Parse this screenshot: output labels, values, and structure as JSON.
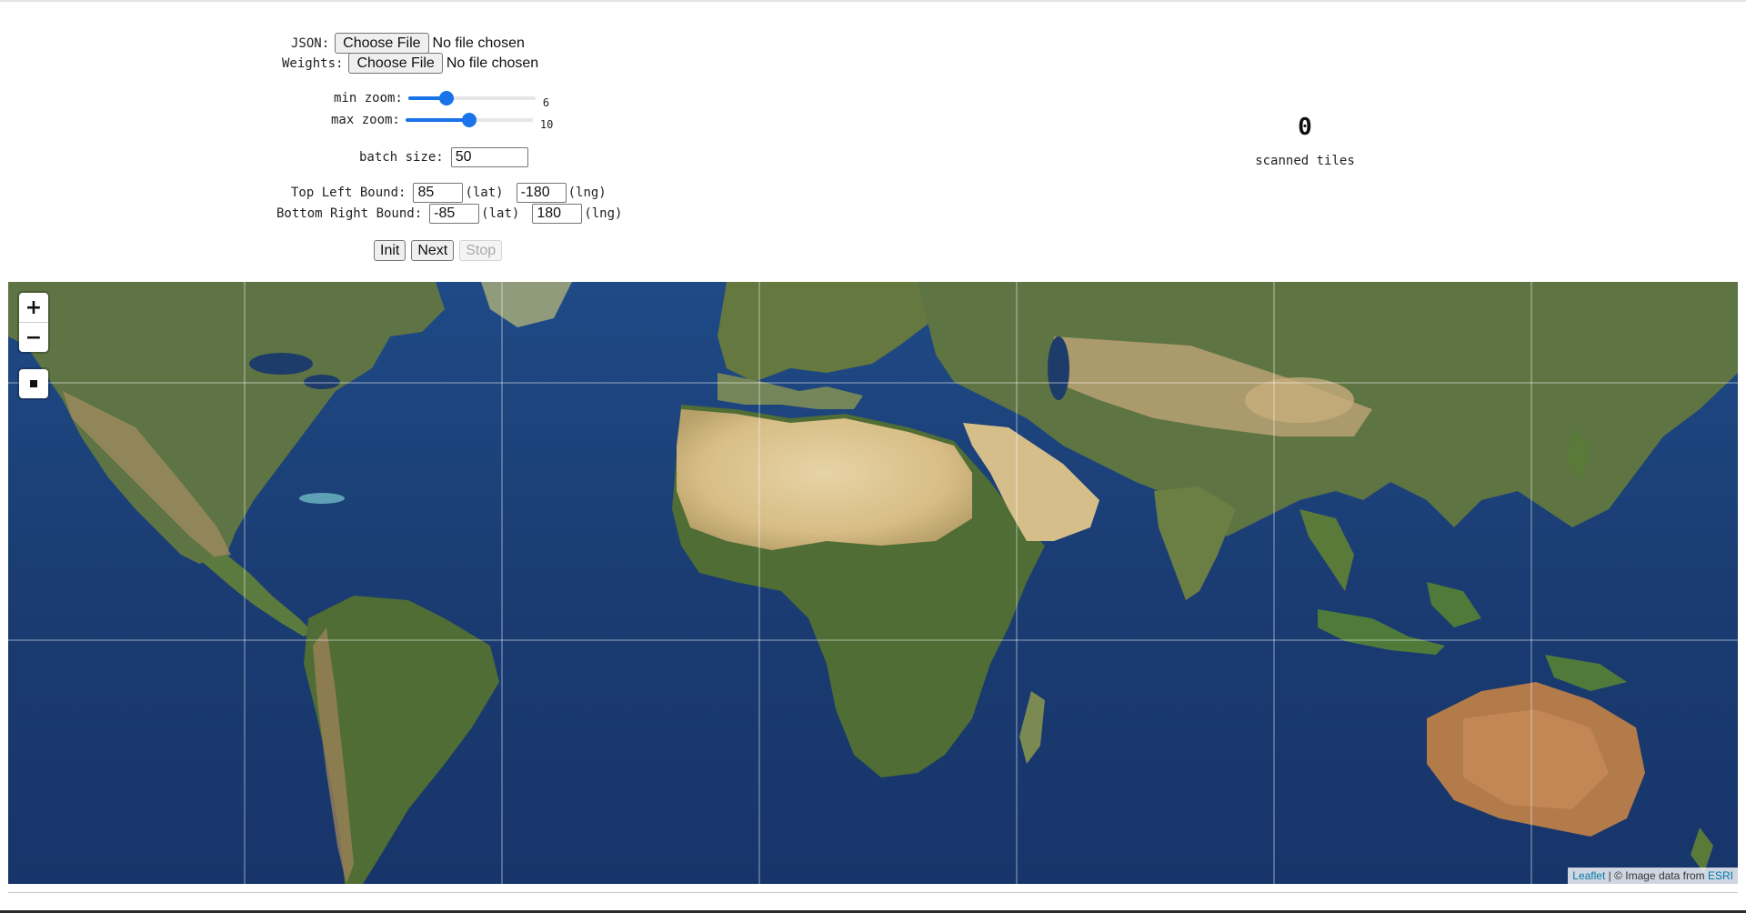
{
  "form": {
    "json_label": "JSON:",
    "weights_label": "Weights:",
    "choose_file_label": "Choose File",
    "no_file_text": "No file chosen",
    "min_zoom_label": "min zoom:",
    "min_zoom_value": "6",
    "min_zoom_fraction": 0.3,
    "max_zoom_label": "max zoom:",
    "max_zoom_value": "10",
    "max_zoom_fraction": 0.5,
    "batch_size_label": "batch size:",
    "batch_size_value": "50",
    "top_left_label": "Top Left Bound:",
    "top_left_lat": "85",
    "top_left_lng": "-180",
    "bottom_right_label": "Bottom Right Bound:",
    "bottom_right_lat": "-85",
    "bottom_right_lng": "180",
    "lat_suffix": "(lat)",
    "lng_suffix": "(lng)",
    "init_label": "Init",
    "next_label": "Next",
    "stop_label": "Stop"
  },
  "counter": {
    "value": "0",
    "label": "scanned tiles"
  },
  "map": {
    "zoom_in": "+",
    "zoom_out": "−",
    "attribution_leaflet": "Leaflet",
    "attribution_sep": " | © Image data from ",
    "attribution_esri": "ESRI",
    "ocean_color": "#1c3f77",
    "icons": [
      "zoom-in-icon",
      "zoom-out-icon",
      "square-draw-icon"
    ]
  }
}
